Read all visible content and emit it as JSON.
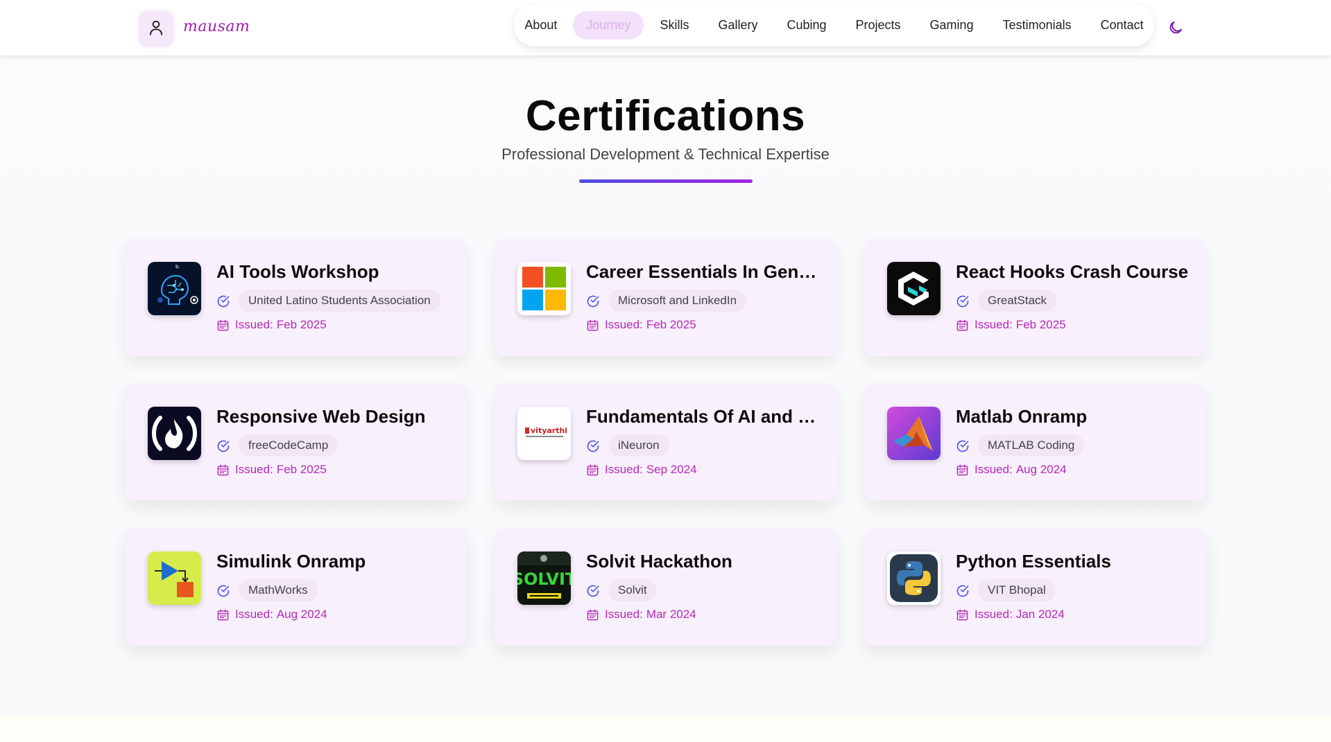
{
  "header": {
    "logo_text": "mausam",
    "nav": [
      {
        "label": "About",
        "active": false
      },
      {
        "label": "Journey",
        "active": true
      },
      {
        "label": "Skills",
        "active": false
      },
      {
        "label": "Gallery",
        "active": false
      },
      {
        "label": "Cubing",
        "active": false
      },
      {
        "label": "Projects",
        "active": false
      },
      {
        "label": "Gaming",
        "active": false
      },
      {
        "label": "Testimonials",
        "active": false
      },
      {
        "label": "Contact",
        "active": false
      }
    ],
    "theme_toggle_icon": "moon-icon"
  },
  "section": {
    "title": "Certifications",
    "subtitle": "Professional Development & Technical Expertise"
  },
  "certifications": [
    {
      "title": "AI Tools Workshop",
      "issuer": "United Latino Students Association",
      "issued_label": "Issued:",
      "date": "Feb 2025",
      "logo": "ai-brain"
    },
    {
      "title": "Career Essentials In Generative AI",
      "issuer": "Microsoft and LinkedIn",
      "issued_label": "Issued:",
      "date": "Feb 2025",
      "logo": "microsoft"
    },
    {
      "title": "React Hooks Crash Course",
      "issuer": "GreatStack",
      "issued_label": "Issued:",
      "date": "Feb 2025",
      "logo": "greatstack"
    },
    {
      "title": "Responsive Web Design",
      "issuer": "freeCodeCamp",
      "issued_label": "Issued:",
      "date": "Feb 2025",
      "logo": "freecodecamp"
    },
    {
      "title": "Fundamentals Of AI and ML",
      "issuer": "iNeuron",
      "issued_label": "Issued:",
      "date": "Sep 2024",
      "logo": "vityarthi",
      "logo_text": "vityarthi"
    },
    {
      "title": "Matlab Onramp",
      "issuer": "MATLAB Coding",
      "issued_label": "Issued:",
      "date": "Aug 2024",
      "logo": "matlab"
    },
    {
      "title": "Simulink Onramp",
      "issuer": "MathWorks",
      "issued_label": "Issued:",
      "date": "Aug 2024",
      "logo": "simulink"
    },
    {
      "title": "Solvit Hackathon",
      "issuer": "Solvit",
      "issued_label": "Issued:",
      "date": "Mar 2024",
      "logo": "solvit",
      "logo_text": "SOLVIT"
    },
    {
      "title": "Python Essentials",
      "issuer": "VIT Bhopal",
      "issued_label": "Issued:",
      "date": "Jan 2024",
      "logo": "python"
    }
  ],
  "colors": {
    "accent_purple": "#b429b8",
    "check_blue": "#4a56e2",
    "card_bg": "#f8f0fc",
    "underline_start": "#4b4fe0",
    "underline_end": "#a326e0"
  }
}
